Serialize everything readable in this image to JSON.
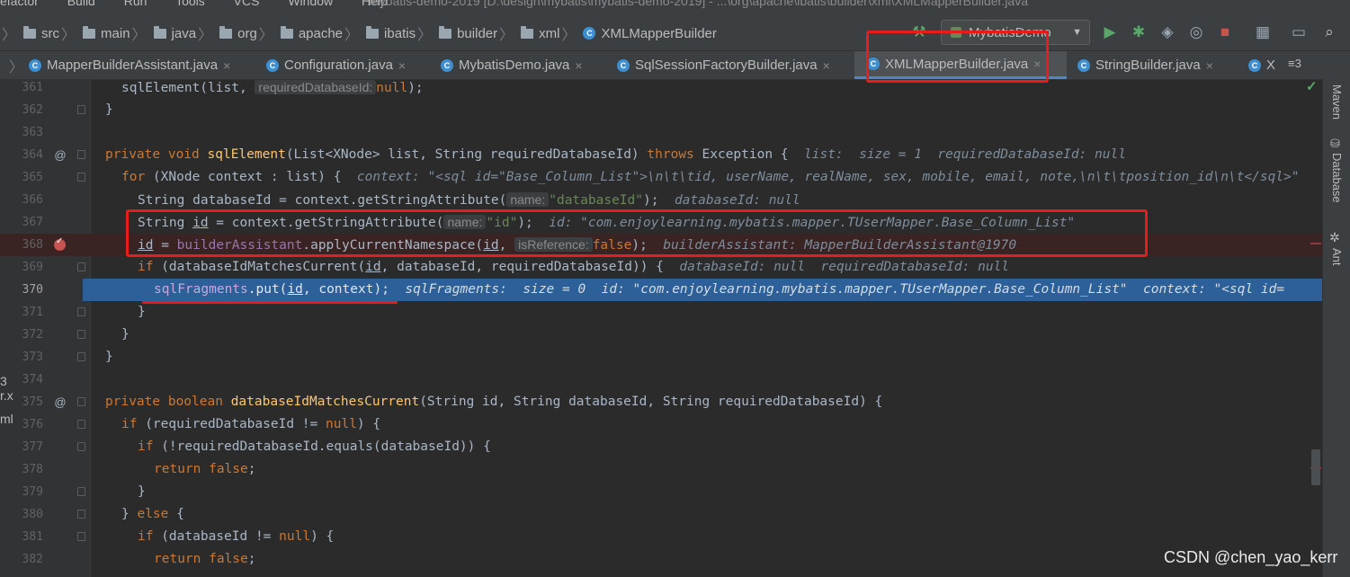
{
  "menu": [
    "efactor",
    "Build",
    "Run",
    "Tools",
    "VCS",
    "Window",
    "Help"
  ],
  "window_title": "mybatis-demo-2019 [D:\\design\\mybatis\\mybatis-demo-2019] - ...\\org\\apache\\ibatis\\builder\\xml\\XMLMapperBuilder.java",
  "breadcrumbs": [
    "src",
    "main",
    "java",
    "org",
    "apache",
    "ibatis",
    "builder",
    "xml",
    "XMLMapperBuilder"
  ],
  "run_config": "MybatisDemo",
  "tabs": [
    {
      "label": "MapperBuilderAssistant.java"
    },
    {
      "label": "Configuration.java"
    },
    {
      "label": "MybatisDemo.java"
    },
    {
      "label": "SqlSessionFactoryBuilder.java"
    },
    {
      "label": "XMLMapperBuilder.java"
    },
    {
      "label": "StringBuilder.java"
    },
    {
      "label": "X"
    }
  ],
  "tab_overflow": "≡3",
  "side_tabs": [
    "Maven",
    "Database",
    "Ant"
  ],
  "left_stub": [
    "r.x",
    "ml",
    "3"
  ],
  "code": {
    "l361": {
      "num": "361",
      "a": "sqlElement(list, ",
      "hint": "requiredDatabaseId:",
      "b": "null",
      "c": ");"
    },
    "l362": {
      "num": "362",
      "a": "}"
    },
    "l363": {
      "num": "363"
    },
    "l364": {
      "num": "364",
      "k1": "private void ",
      "fn": "sqlElement",
      "a": "(List<XNode> list, String requiredDatabaseId) ",
      "k2": "throws",
      "b": " Exception {",
      "dbg": "list:  size = 1  requiredDatabaseId: null"
    },
    "l365": {
      "num": "365",
      "k1": "for",
      "a": " (XNode context : list) {",
      "dbg": "context: \"<sql id=\"Base_Column_List\">\\n\\t\\tid, userName, realName, sex, mobile, email, note,\\n\\t\\tposition_id\\n\\t</sql>\""
    },
    "l366": {
      "num": "366",
      "a": "String databaseId = context.getStringAttribute(",
      "hint": "name:",
      "str": "\"databaseId\"",
      "b": ");",
      "dbg": "databaseId: null"
    },
    "l367": {
      "num": "367",
      "a": "String ",
      "v": "id",
      "b": " = context.getStringAttribute(",
      "hint": "name:",
      "str": "\"id\"",
      "c": ");",
      "dbg": "id: \"com.enjoylearning.mybatis.mapper.TUserMapper.Base_Column_List\""
    },
    "l368": {
      "num": "368",
      "v": "id",
      "a": " = ",
      "fld": "builderAssistant",
      "b": ".applyCurrentNamespace(",
      "v2": "id",
      "c": ", ",
      "hint": "isReference:",
      "k1": "false",
      "d": ");",
      "dbg": "builderAssistant: MapperBuilderAssistant@1970"
    },
    "l369": {
      "num": "369",
      "k1": "if",
      "a": " (databaseIdMatchesCurrent(",
      "v": "id",
      "b": ", databaseId, requiredDatabaseId)) {",
      "dbg": "databaseId: null  requiredDatabaseId: null"
    },
    "l370": {
      "num": "370",
      "fld": "sqlFragments",
      "a": ".put(",
      "v": "id",
      "b": ", context);",
      "dbg": "sqlFragments:  size = 0  id: \"com.enjoylearning.mybatis.mapper.TUserMapper.Base_Column_List\"  context: \"<sql id="
    },
    "l371": {
      "num": "371",
      "a": "}"
    },
    "l372": {
      "num": "372",
      "a": "}"
    },
    "l373": {
      "num": "373",
      "a": "}"
    },
    "l374": {
      "num": "374"
    },
    "l375": {
      "num": "375",
      "k1": "private boolean ",
      "fn": "databaseIdMatchesCurrent",
      "a": "(String id, String databaseId, String requiredDatabaseId) {"
    },
    "l376": {
      "num": "376",
      "k1": "if",
      "a": " (requiredDatabaseId != ",
      "k2": "null",
      "b": ") {"
    },
    "l377": {
      "num": "377",
      "k1": "if",
      "a": " (!requiredDatabaseId.equals(databaseId)) {"
    },
    "l378": {
      "num": "378",
      "k1": "return false",
      "a": ";"
    },
    "l379": {
      "num": "379",
      "a": "}"
    },
    "l380": {
      "num": "380",
      "a": "} ",
      "k1": "else",
      "b": " {"
    },
    "l381": {
      "num": "381",
      "k1": "if",
      "a": " (databaseId != ",
      "k2": "null",
      "b": ") {"
    },
    "l382": {
      "num": "382",
      "k1": "return false",
      "a": ";"
    }
  },
  "watermark": "CSDN @chen_yao_kerr",
  "colors": {
    "highlight": "#e81c1c",
    "execution_line": "#2d6099",
    "keyword": "#cc7832",
    "string": "#6a8759"
  }
}
